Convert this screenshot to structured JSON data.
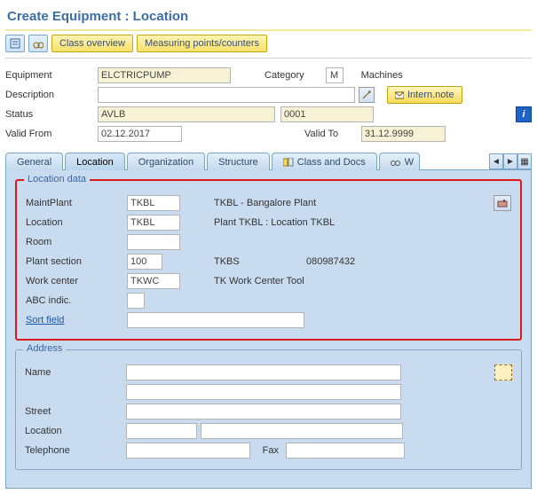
{
  "title": "Create Equipment : Location",
  "toolbar": {
    "class_overview": "Class overview",
    "measuring_points": "Measuring points/counters"
  },
  "header": {
    "equipment_label": "Equipment",
    "equipment_value": "ELCTRICPUMP",
    "category_label": "Category",
    "category_code": "M",
    "category_text": "Machines",
    "description_label": "Description",
    "description_value": "",
    "intern_note": "Intern.note",
    "status_label": "Status",
    "status_value": "AVLB",
    "status_sub": "0001",
    "valid_from_label": "Valid From",
    "valid_from_value": "02.12.2017",
    "valid_to_label": "Valid To",
    "valid_to_value": "31.12.9999"
  },
  "tabs": {
    "general": "General",
    "location": "Location",
    "organization": "Organization",
    "structure": "Structure",
    "class_docs": "Class and Docs",
    "w": "W"
  },
  "location_data": {
    "group_title": "Location data",
    "maint_plant_label": "MaintPlant",
    "maint_plant_value": "TKBL",
    "maint_plant_desc": "TKBL - Bangalore Plant",
    "location_label": "Location",
    "location_value": "TKBL",
    "location_desc": "Plant TKBL : Location TKBL",
    "room_label": "Room",
    "room_value": "",
    "plant_section_label": "Plant section",
    "plant_section_value": "100",
    "section_code": "TKBS",
    "section_num": "080987432",
    "work_center_label": "Work center",
    "work_center_value": "TKWC",
    "work_center_desc": "TK Work Center Tool",
    "abc_label": "ABC indic.",
    "abc_value": "",
    "sort_field_label": "Sort field",
    "sort_field_value": ""
  },
  "address": {
    "group_title": "Address",
    "name_label": "Name",
    "name1": "",
    "name2": "",
    "street_label": "Street",
    "street_value": "",
    "loc_label": "Location",
    "loc1": "",
    "loc2": "",
    "tel_label": "Telephone",
    "tel_value": "",
    "fax_label": "Fax",
    "fax_value": ""
  }
}
